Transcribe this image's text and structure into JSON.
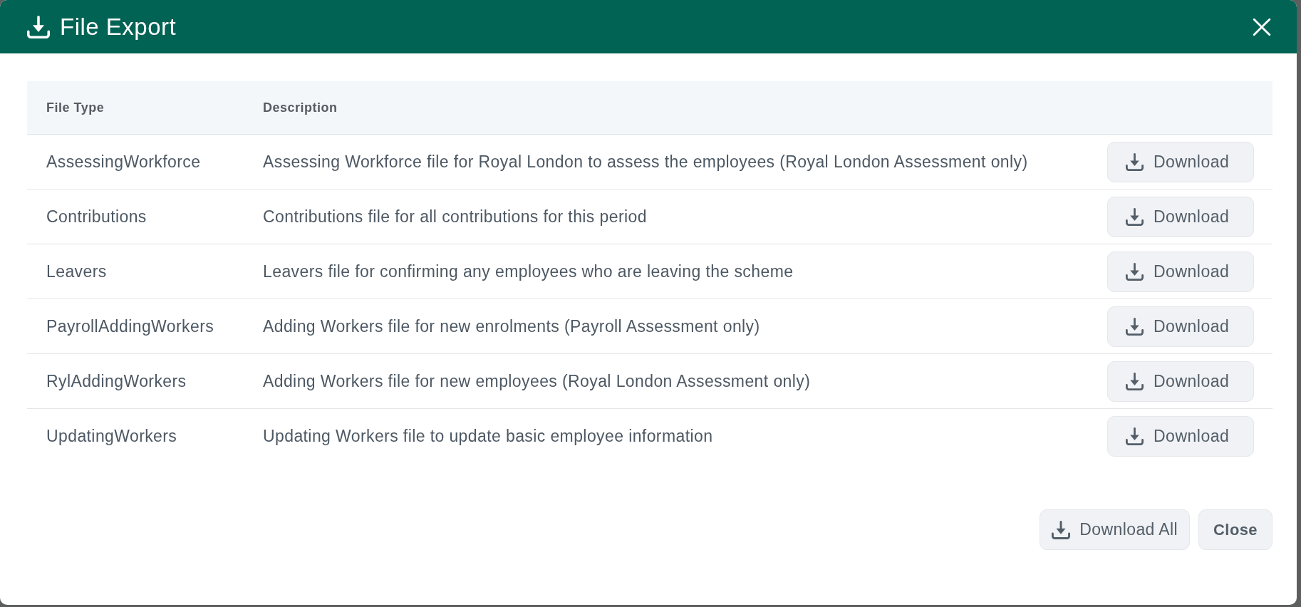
{
  "dialog": {
    "title": "File Export",
    "table": {
      "columns": [
        "File Type",
        "Description"
      ],
      "rows": [
        {
          "file_type": "AssessingWorkforce",
          "description": "Assessing Workforce file for Royal London to assess the employees (Royal London Assessment only)",
          "action": "Download"
        },
        {
          "file_type": "Contributions",
          "description": "Contributions file for all contributions for this period",
          "action": "Download"
        },
        {
          "file_type": "Leavers",
          "description": "Leavers file for confirming any employees who are leaving the scheme",
          "action": "Download"
        },
        {
          "file_type": "PayrollAddingWorkers",
          "description": "Adding Workers file for new enrolments (Payroll Assessment only)",
          "action": "Download"
        },
        {
          "file_type": "RylAddingWorkers",
          "description": "Adding Workers file for new employees (Royal London Assessment only)",
          "action": "Download"
        },
        {
          "file_type": "UpdatingWorkers",
          "description": "Updating Workers file to update basic employee information",
          "action": "Download"
        }
      ]
    },
    "footer_buttons": [
      {
        "label": "Download All",
        "kind": "download"
      },
      {
        "label": "Close",
        "kind": "plain"
      }
    ]
  }
}
